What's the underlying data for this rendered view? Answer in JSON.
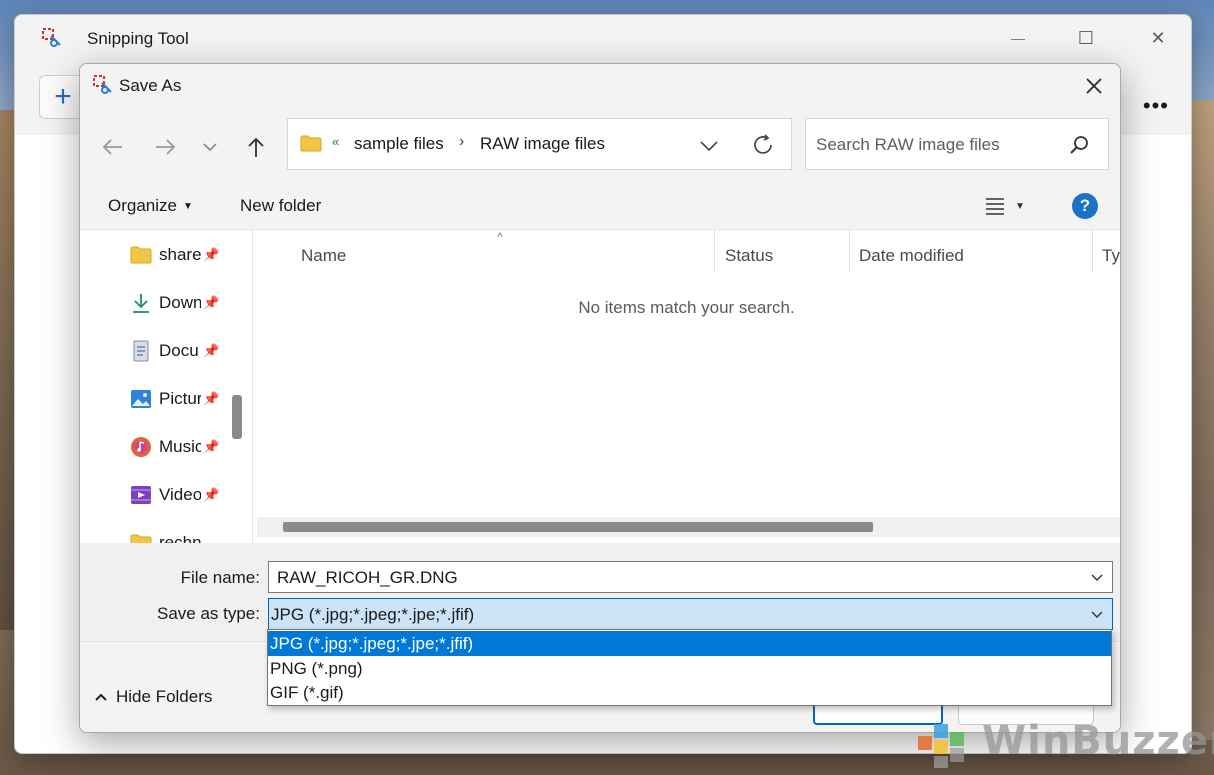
{
  "snipping_tool": {
    "title": "Snipping Tool",
    "new_label": "+",
    "more_label": "•••",
    "minimize_glyph": "—",
    "maximize_glyph": "☐",
    "close_glyph": "✕"
  },
  "dialog": {
    "title": "Save As",
    "address": {
      "overflow_chevron": "«",
      "crumbs": [
        "sample files",
        "RAW image files"
      ],
      "separator": "›"
    },
    "search": {
      "placeholder": "Search RAW image files"
    },
    "commands": {
      "organize": "Organize",
      "new_folder": "New folder",
      "help": "?"
    },
    "nav_items": [
      {
        "label": "share",
        "icon": "folder-icon"
      },
      {
        "label": "Downl",
        "icon": "downloads-icon"
      },
      {
        "label": "Docu",
        "icon": "documents-icon"
      },
      {
        "label": "Pictur",
        "icon": "pictures-icon"
      },
      {
        "label": "Music",
        "icon": "music-icon"
      },
      {
        "label": "Video",
        "icon": "videos-icon"
      },
      {
        "label": "rechn",
        "icon": "folder-icon"
      }
    ],
    "columns": [
      "Name",
      "Status",
      "Date modified",
      "Typ"
    ],
    "empty_message": "No items match your search.",
    "file_name_label": "File name:",
    "file_name_value": "RAW_RICOH_GR.DNG",
    "save_type_label": "Save as type:",
    "save_type_value": "JPG (*.jpg;*.jpeg;*.jpe;*.jfif)",
    "type_options": [
      "JPG (*.jpg;*.jpeg;*.jpe;*.jfif)",
      "PNG (*.png)",
      "GIF (*.gif)"
    ],
    "selected_type_index": 0,
    "hide_folders": "Hide Folders"
  },
  "watermark": {
    "text": "WinBuzzer"
  },
  "colors": {
    "accent": "#0078d7",
    "help_blue": "#1a73c8",
    "selection_bg": "#cce4f7"
  }
}
